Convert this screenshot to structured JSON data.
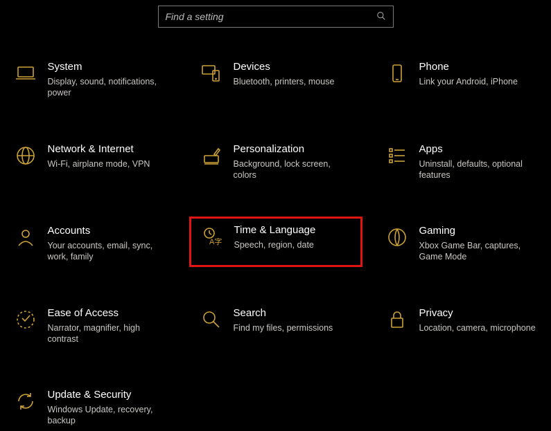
{
  "search": {
    "placeholder": "Find a setting"
  },
  "accent": "#cda236",
  "categories": [
    {
      "id": "system",
      "icon": "laptop",
      "title": "System",
      "subtitle": "Display, sound, notifications, power"
    },
    {
      "id": "devices",
      "icon": "devices",
      "title": "Devices",
      "subtitle": "Bluetooth, printers, mouse"
    },
    {
      "id": "phone",
      "icon": "phone",
      "title": "Phone",
      "subtitle": "Link your Android, iPhone"
    },
    {
      "id": "network",
      "icon": "globe",
      "title": "Network & Internet",
      "subtitle": "Wi-Fi, airplane mode, VPN"
    },
    {
      "id": "personalization",
      "icon": "brush",
      "title": "Personalization",
      "subtitle": "Background, lock screen, colors"
    },
    {
      "id": "apps",
      "icon": "list",
      "title": "Apps",
      "subtitle": "Uninstall, defaults, optional features"
    },
    {
      "id": "accounts",
      "icon": "person",
      "title": "Accounts",
      "subtitle": "Your accounts, email, sync, work, family"
    },
    {
      "id": "time-language",
      "icon": "time-lang",
      "title": "Time & Language",
      "subtitle": "Speech, region, date",
      "highlight": true
    },
    {
      "id": "gaming",
      "icon": "gaming",
      "title": "Gaming",
      "subtitle": "Xbox Game Bar, captures, Game Mode"
    },
    {
      "id": "ease-of-access",
      "icon": "ease",
      "title": "Ease of Access",
      "subtitle": "Narrator, magnifier, high contrast"
    },
    {
      "id": "search",
      "icon": "search",
      "title": "Search",
      "subtitle": "Find my files, permissions"
    },
    {
      "id": "privacy",
      "icon": "lock",
      "title": "Privacy",
      "subtitle": "Location, camera, microphone"
    },
    {
      "id": "update-security",
      "icon": "sync",
      "title": "Update & Security",
      "subtitle": "Windows Update, recovery, backup"
    }
  ]
}
